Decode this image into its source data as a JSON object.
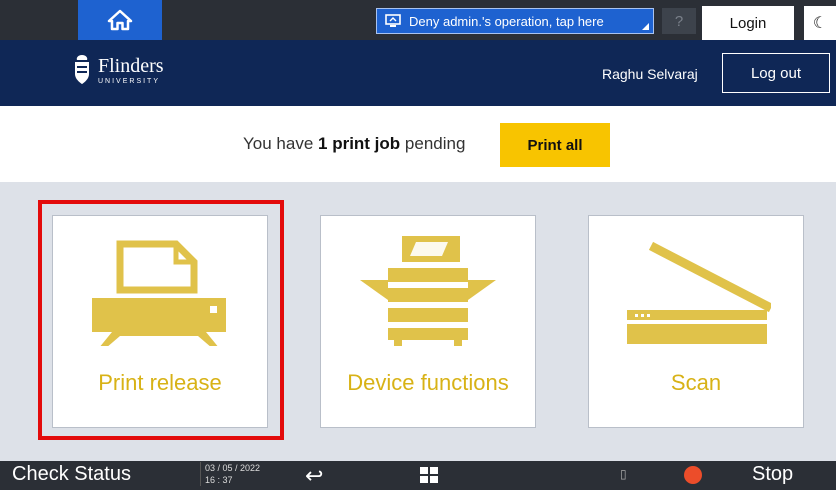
{
  "system_bar": {
    "deny_label": "Deny admin.'s operation, tap here",
    "help_label": "?",
    "login_label": "Login",
    "moon_label": "☾"
  },
  "header": {
    "brand": "Flinders",
    "brand_sub": "UNIVERSITY",
    "user": "Raghu Selvaraj",
    "logout_label": "Log out"
  },
  "pending": {
    "prefix": "You have ",
    "count": "1",
    "job_word": " print job",
    "suffix": " pending",
    "print_all_label": "Print all"
  },
  "tiles": [
    {
      "label": "Print release",
      "icon": "printer-icon"
    },
    {
      "label": "Device functions",
      "icon": "copier-icon"
    },
    {
      "label": "Scan",
      "icon": "scanner-icon"
    }
  ],
  "bottom_bar": {
    "check_status_label": "Check Status",
    "date": "03 / 05 / 2022",
    "time": "16 : 37",
    "stop_label": "Stop"
  },
  "colors": {
    "accent_yellow": "#f8c400",
    "icon_yellow": "#e0c24a",
    "navy": "#0f2756",
    "system_blue": "#1e62d0",
    "highlight_red": "#e30b0b"
  }
}
